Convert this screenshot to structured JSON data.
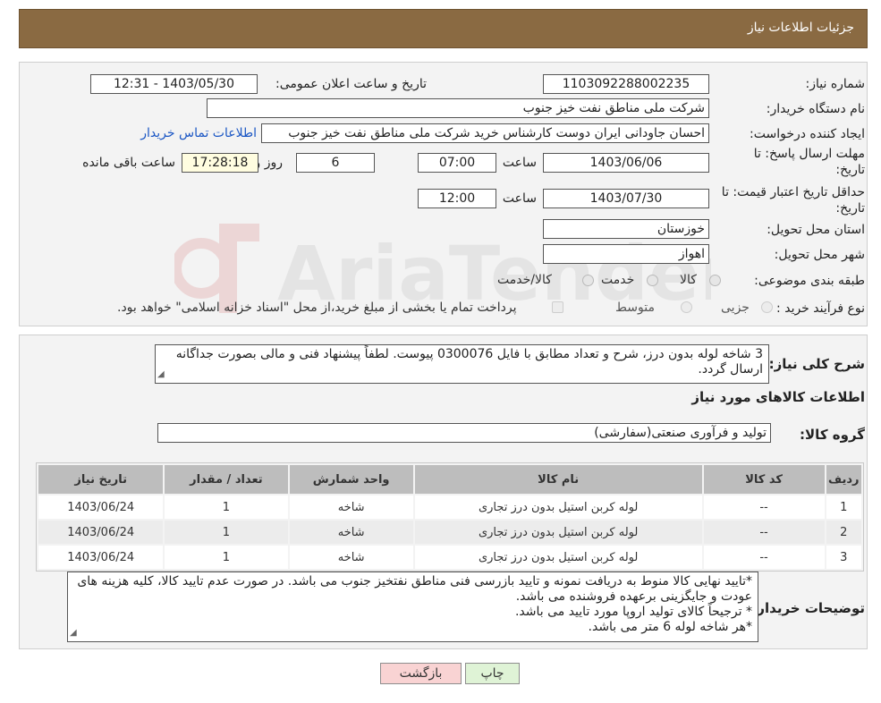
{
  "header": {
    "title": "جزئیات اطلاعات نیاز"
  },
  "form": {
    "need_number_label": "شماره نیاز:",
    "need_number": "1103092288002235",
    "announce_label": "تاریخ و ساعت اعلان عمومی:",
    "announce_value": "1403/05/30 - 12:31",
    "buyer_org_label": "نام دستگاه خریدار:",
    "buyer_org": "شرکت ملی مناطق نفت خیز جنوب",
    "creator_label": "ایجاد کننده درخواست:",
    "creator": "احسان جاودانی ایران دوست کارشناس خرید شرکت ملی مناطق نفت خیز جنوب",
    "contact_link": "اطلاعات تماس خریدار",
    "deadline_label_1": "مهلت ارسال پاسخ: تا",
    "deadline_label_2": "تاریخ:",
    "deadline_date": "1403/06/06",
    "time_label": "ساعت",
    "deadline_time": "07:00",
    "days_value": "6",
    "days_label": "روز و",
    "remaining_time": "17:28:18",
    "remaining_label": "ساعت باقی مانده",
    "price_validity_label_1": "حداقل تاریخ اعتبار قیمت: تا",
    "price_validity_label_2": "تاریخ:",
    "price_validity_date": "1403/07/30",
    "price_validity_time": "12:00",
    "province_label": "استان محل تحویل:",
    "province": "خوزستان",
    "city_label": "شهر محل تحویل:",
    "city": "اهواز",
    "category_label": "طبقه بندی موضوعی:",
    "category_options": [
      "کالا",
      "خدمت",
      "کالا/خدمت"
    ],
    "process_label": "نوع فرآیند خرید :",
    "process_options": [
      "جزیی",
      "متوسط"
    ],
    "payment_note": "پرداخت تمام یا بخشی از مبلغ خرید،از محل \"اسناد خزانه اسلامی\" خواهد بود."
  },
  "description": {
    "label": "شرح کلی نیاز:",
    "text": "3 شاخه لوله بدون درز، شرح و تعداد مطابق با فایل 0300076 پیوست. لطفاً پیشنهاد فنی و مالی بصورت جداگانه ارسال گردد."
  },
  "goods_section_title": "اطلاعات کالاهای مورد نیاز",
  "goods_group": {
    "label": "گروه کالا:",
    "value": "تولید و فرآوری صنعتی(سفارشی)"
  },
  "table": {
    "headers": [
      "ردیف",
      "کد کالا",
      "نام کالا",
      "واحد شمارش",
      "تعداد / مقدار",
      "تاریخ نیاز"
    ],
    "rows": [
      [
        "1",
        "--",
        "لوله کربن استیل بدون درز تجاری",
        "شاخه",
        "1",
        "1403/06/24"
      ],
      [
        "2",
        "--",
        "لوله کربن استیل بدون درز تجاری",
        "شاخه",
        "1",
        "1403/06/24"
      ],
      [
        "3",
        "--",
        "لوله کربن استیل بدون درز تجاری",
        "شاخه",
        "1",
        "1403/06/24"
      ]
    ]
  },
  "buyer_notes": {
    "label": "توضیحات خریدار:",
    "lines": [
      "*تایید نهایی کالا منوط به دریافت نمونه و تایید بازرسی فنی مناطق نفتخیز جنوب می باشد. در صورت عدم تایید کالا، کلیه هزینه های عودت و جایگزینی برعهده فروشنده می باشد.",
      "* ترجیحاً کالای تولید اروپا مورد تایید می باشد.",
      "*هر شاخه لوله 6 متر می باشد."
    ]
  },
  "buttons": {
    "print": "چاپ",
    "back": "بازگشت"
  },
  "watermark": {
    "text": "AriaTender.neT"
  },
  "colors": {
    "header_bg": "#8a6a42",
    "print_bg": "#dff3d6",
    "back_bg": "#f9d3d3",
    "link": "#1a56c4"
  }
}
